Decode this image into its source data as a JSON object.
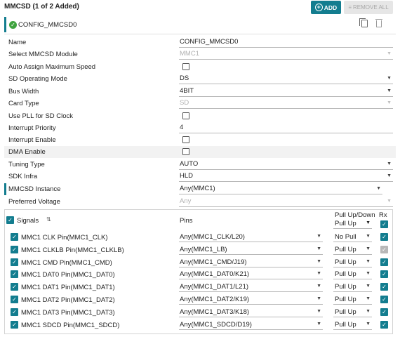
{
  "header": {
    "title": "MMCSD (1 of 2 Added)",
    "add_label": "ADD",
    "remove_all_label": "REMOVE ALL"
  },
  "instance": {
    "name": "CONFIG_MMCSD0"
  },
  "config": [
    {
      "label": "Name",
      "type": "text",
      "value": "CONFIG_MMCSD0"
    },
    {
      "label": "Select MMCSD Module",
      "type": "select",
      "value": "MMC1",
      "disabled": true
    },
    {
      "label": "Auto Assign Maximum Speed",
      "type": "checkbox",
      "checked": false
    },
    {
      "label": "SD Operating Mode",
      "type": "select",
      "value": "DS"
    },
    {
      "label": "Bus Width",
      "type": "select",
      "value": "4BIT"
    },
    {
      "label": "Card Type",
      "type": "select",
      "value": "SD",
      "disabled": true
    },
    {
      "label": "Use PLL for SD Clock",
      "type": "checkbox",
      "checked": false
    },
    {
      "label": "Interrupt Priority",
      "type": "text",
      "value": "4"
    },
    {
      "label": "Interrupt Enable",
      "type": "checkbox",
      "checked": false
    },
    {
      "label": "DMA Enable",
      "type": "checkbox",
      "checked": false
    },
    {
      "label": "Tuning Type",
      "type": "select",
      "value": "AUTO"
    },
    {
      "label": "SDK Infra",
      "type": "select",
      "value": "HLD"
    },
    {
      "label": "MMCSD Instance",
      "type": "select",
      "value": "Any(MMC1)"
    },
    {
      "label": "Preferred Voltage",
      "type": "select",
      "value": "Any",
      "disabled": true
    }
  ],
  "signals_table": {
    "col_signals": "Signals",
    "col_pins": "Pins",
    "col_pull": "Pull Up/Down",
    "col_rx": "Rx",
    "header_pull_value": "Pull Up",
    "rows": [
      {
        "signal": "MMC1 CLK Pin(MMC1_CLK)",
        "pin": "Any(MMC1_CLK/L20)",
        "pull": "No Pull",
        "rx_disabled": false
      },
      {
        "signal": "MMC1 CLKLB Pin(MMC1_CLKLB)",
        "pin": "Any(MMC1_LB)",
        "pull": "Pull Up",
        "rx_disabled": true
      },
      {
        "signal": "MMC1 CMD Pin(MMC1_CMD)",
        "pin": "Any(MMC1_CMD/J19)",
        "pull": "Pull Up",
        "rx_disabled": false
      },
      {
        "signal": "MMC1 DAT0 Pin(MMC1_DAT0)",
        "pin": "Any(MMC1_DAT0/K21)",
        "pull": "Pull Up",
        "rx_disabled": false
      },
      {
        "signal": "MMC1 DAT1 Pin(MMC1_DAT1)",
        "pin": "Any(MMC1_DAT1/L21)",
        "pull": "Pull Up",
        "rx_disabled": false
      },
      {
        "signal": "MMC1 DAT2 Pin(MMC1_DAT2)",
        "pin": "Any(MMC1_DAT2/K19)",
        "pull": "Pull Up",
        "rx_disabled": false
      },
      {
        "signal": "MMC1 DAT3 Pin(MMC1_DAT3)",
        "pin": "Any(MMC1_DAT3/K18)",
        "pull": "Pull Up",
        "rx_disabled": false
      },
      {
        "signal": "MMC1 SDCD Pin(MMC1_SDCD)",
        "pin": "Any(MMC1_SDCD/D19)",
        "pull": "Pull Up",
        "rx_disabled": false
      }
    ]
  },
  "colors": {
    "accent": "#137d8f",
    "success": "#3fa33f"
  },
  "icons": [
    "add-icon",
    "remove-all-icon",
    "check-circle-icon",
    "copy-icon",
    "trash-icon",
    "sort-icon",
    "chevron-down-icon",
    "checkbox-icon"
  ]
}
